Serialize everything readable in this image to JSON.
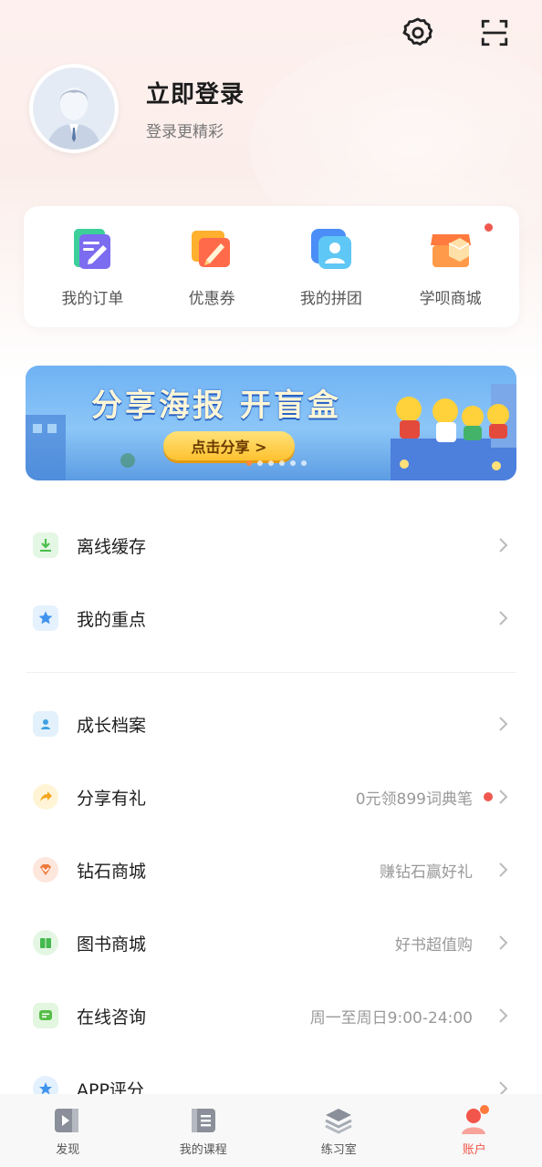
{
  "header": {
    "settings_icon": "gear-icon",
    "scan_icon": "scan-icon"
  },
  "profile": {
    "title": "立即登录",
    "subtitle": "登录更精彩"
  },
  "quick_actions": [
    {
      "label": "我的订单",
      "icon": "orders-icon"
    },
    {
      "label": "优惠券",
      "icon": "coupon-icon"
    },
    {
      "label": "我的拼团",
      "icon": "group-buy-icon"
    },
    {
      "label": "学呗商城",
      "icon": "shop-icon",
      "badge": true
    }
  ],
  "banner": {
    "title": "分享海报 开盲盒",
    "button": "点击分享 >"
  },
  "menu": [
    {
      "label": "离线缓存",
      "extra": "",
      "icon": "download-icon",
      "color": "#5ac35d"
    },
    {
      "label": "我的重点",
      "extra": "",
      "icon": "star-icon",
      "color": "#4a9df0"
    },
    {
      "label": "成长档案",
      "extra": "",
      "icon": "profile-card-icon",
      "color": "#4aa8e6"
    },
    {
      "label": "分享有礼",
      "extra": "0元领899词典笔",
      "icon": "share-icon",
      "color": "#f5a623",
      "dot": true
    },
    {
      "label": "钻石商城",
      "extra": "赚钻石赢好礼",
      "icon": "diamond-icon",
      "color": "#f07a3c"
    },
    {
      "label": "图书商城",
      "extra": "好书超值购",
      "icon": "book-icon",
      "color": "#4cbf56"
    },
    {
      "label": "在线咨询",
      "extra": "周一至周日9:00-24:00",
      "icon": "chat-icon",
      "color": "#57c04a"
    },
    {
      "label": "APP评分",
      "extra": "",
      "icon": "rating-icon",
      "color": "#4a9df0"
    }
  ],
  "tabbar": [
    {
      "label": "发现",
      "icon": "discover-icon"
    },
    {
      "label": "我的课程",
      "icon": "courses-icon"
    },
    {
      "label": "练习室",
      "icon": "practice-icon"
    },
    {
      "label": "账户",
      "icon": "account-icon",
      "active": true
    }
  ],
  "colors": {
    "accent": "#f25549",
    "text_primary": "#1e1e1e",
    "text_secondary": "#999999"
  }
}
